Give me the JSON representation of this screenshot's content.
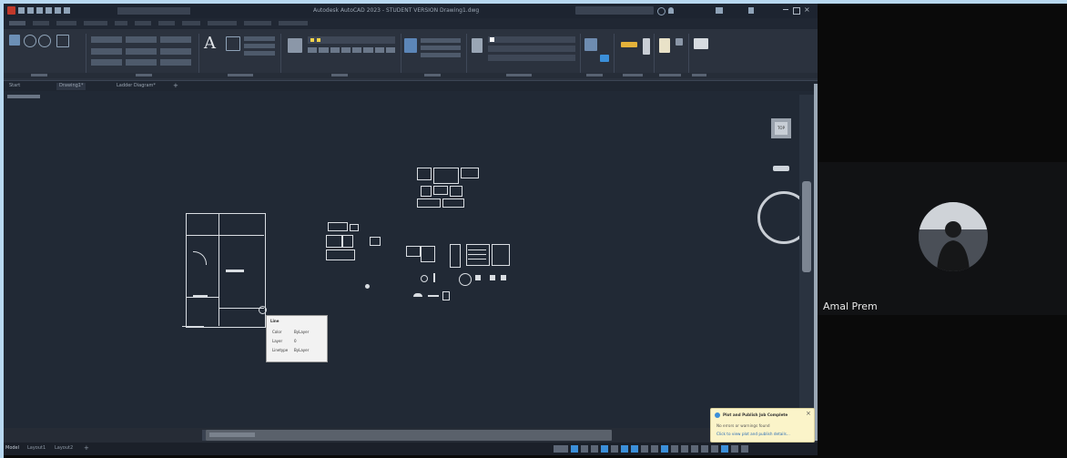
{
  "cad": {
    "title": "Autodesk AutoCAD 2023 - STUDENT VERSION   Drawing1.dwg",
    "doc_tabs": [
      "Start",
      "Drawing1*",
      "Ladder Diagram*"
    ],
    "viewcube_face": "TOP",
    "tooltip": {
      "title": "Line",
      "rows": [
        {
          "key": "Color",
          "value": "ByLayer"
        },
        {
          "key": "Layer",
          "value": "0"
        },
        {
          "key": "Linetype",
          "value": "ByLayer"
        }
      ]
    },
    "notification": {
      "title": "Plot and Publish Job Complete",
      "line1": "No errors or warnings found",
      "line2": "Click to view plot and publish details..."
    },
    "status_left": [
      "Model",
      "Layout1",
      "Layout2"
    ],
    "colors": {
      "canvas": "#212935",
      "ribbon": "#2b323e",
      "accent": "#3b8fd9"
    }
  },
  "video": {
    "participant_name": "Amal Prem"
  }
}
